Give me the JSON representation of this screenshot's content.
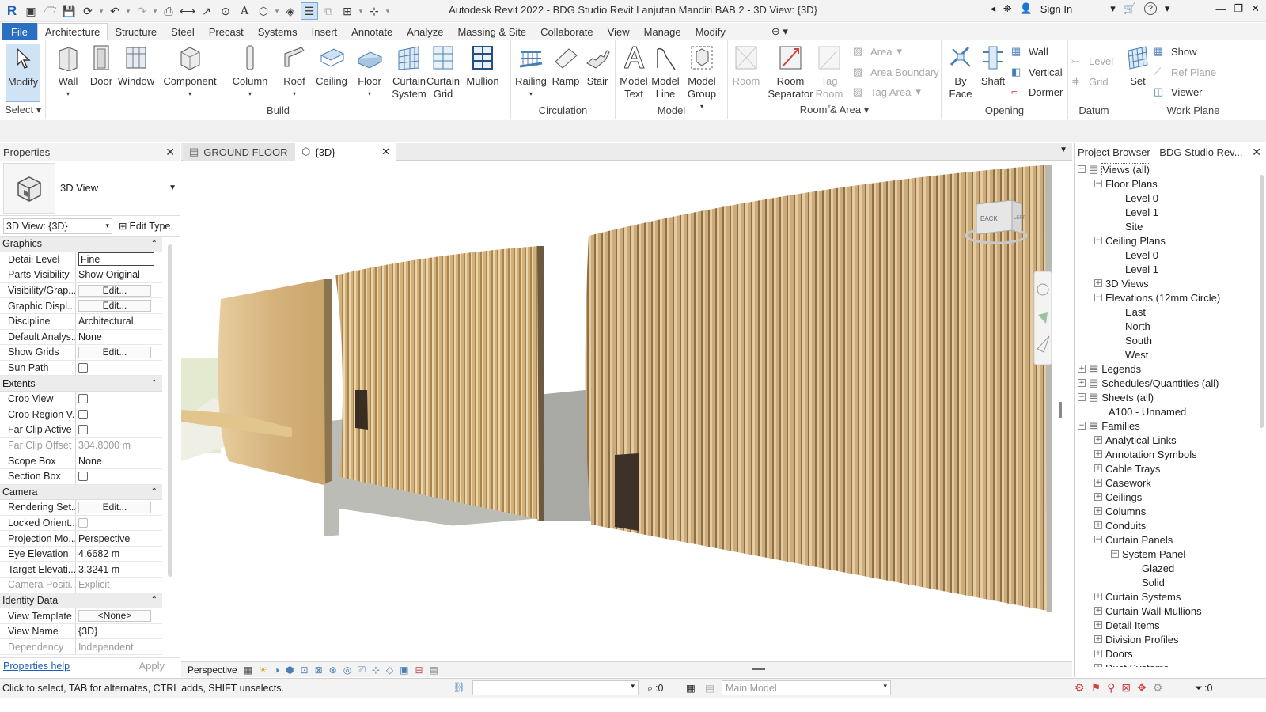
{
  "app": {
    "title": "Autodesk Revit 2022 - BDG Studio Revit Lanjutan Mandiri BAB 2 - 3D View: {3D}",
    "sign_in": "Sign In"
  },
  "ribbon_tabs": [
    "File",
    "Architecture",
    "Structure",
    "Steel",
    "Precast",
    "Systems",
    "Insert",
    "Annotate",
    "Analyze",
    "Massing & Site",
    "Collaborate",
    "View",
    "Manage",
    "Modify"
  ],
  "ribbon": {
    "select": {
      "modify": "Modify",
      "label": "Select"
    },
    "build": {
      "label": "Build",
      "buttons": [
        "Wall",
        "Door",
        "Window",
        "Component",
        "Column",
        "Roof",
        "Ceiling",
        "Floor",
        "Curtain System",
        "Curtain Grid",
        "Mullion"
      ]
    },
    "circulation": {
      "label": "Circulation",
      "buttons": [
        "Railing",
        "Ramp",
        "Stair"
      ]
    },
    "model": {
      "label": "Model",
      "buttons": [
        "Model Text",
        "Model Line",
        "Model Group"
      ]
    },
    "room_area": {
      "label": "Room & Area",
      "room": "Room",
      "room_separator": "Room Separator",
      "tag_room": "Tag Room",
      "area": "Area",
      "area_boundary": "Area  Boundary",
      "tag_area": "Tag  Area"
    },
    "opening": {
      "label": "Opening",
      "by_face": "By Face",
      "shaft": "Shaft",
      "wall": "Wall",
      "vertical": "Vertical",
      "dormer": "Dormer"
    },
    "datum": {
      "label": "Datum",
      "level": "Level",
      "grid": "Grid"
    },
    "work_plane": {
      "label": "Work Plane",
      "set": "Set",
      "show": "Show",
      "ref_plane": "Ref  Plane",
      "viewer": "Viewer"
    }
  },
  "properties": {
    "title": "Properties",
    "type_name": "3D View",
    "selector": "3D View: {3D}",
    "edit_type": "Edit Type",
    "help": "Properties help",
    "apply": "Apply",
    "sections": [
      {
        "name": "Graphics",
        "rows": [
          {
            "k": "Detail Level",
            "v": "Fine",
            "kind": "input"
          },
          {
            "k": "Parts Visibility",
            "v": "Show Original"
          },
          {
            "k": "Visibility/Grap...",
            "v": "Edit...",
            "kind": "button"
          },
          {
            "k": "Graphic Displ...",
            "v": "Edit...",
            "kind": "button"
          },
          {
            "k": "Discipline",
            "v": "Architectural"
          },
          {
            "k": "Default Analys...",
            "v": "None"
          },
          {
            "k": "Show Grids",
            "v": "Edit...",
            "kind": "button"
          },
          {
            "k": "Sun Path",
            "v": "",
            "kind": "check"
          }
        ]
      },
      {
        "name": "Extents",
        "rows": [
          {
            "k": "Crop View",
            "v": "",
            "kind": "check"
          },
          {
            "k": "Crop Region V...",
            "v": "",
            "kind": "check"
          },
          {
            "k": "Far Clip Active",
            "v": "",
            "kind": "check"
          },
          {
            "k": "Far Clip Offset",
            "v": "304.8000 m",
            "kind": "disabled"
          },
          {
            "k": "Scope Box",
            "v": "None"
          },
          {
            "k": "Section Box",
            "v": "",
            "kind": "check"
          }
        ]
      },
      {
        "name": "Camera",
        "rows": [
          {
            "k": "Rendering Set...",
            "v": "Edit...",
            "kind": "button"
          },
          {
            "k": "Locked Orient...",
            "v": "",
            "kind": "checkdis"
          },
          {
            "k": "Projection Mo...",
            "v": "Perspective"
          },
          {
            "k": "Eye Elevation",
            "v": "4.6682 m"
          },
          {
            "k": "Target Elevati...",
            "v": "3.3241 m"
          },
          {
            "k": "Camera Positi...",
            "v": "Explicit",
            "kind": "disabled"
          }
        ]
      },
      {
        "name": "Identity Data",
        "rows": [
          {
            "k": "View Template",
            "v": "<None>",
            "kind": "button"
          },
          {
            "k": "View Name",
            "v": "{3D}"
          },
          {
            "k": "Dependency",
            "v": "Independent",
            "kind": "disabled"
          }
        ]
      }
    ]
  },
  "view_tabs": [
    {
      "label": "GROUND FLOOR"
    },
    {
      "label": "{3D}"
    }
  ],
  "view_bar": {
    "mode": "Perspective"
  },
  "viewcube": {
    "back": "BACK",
    "left": "LEFT"
  },
  "browser": {
    "title": "Project Browser - BDG Studio Rev...",
    "tree": [
      {
        "label": "Views (all)",
        "level": 0,
        "pm": "−",
        "icon": true
      },
      {
        "label": "Floor Plans",
        "level": 1,
        "pm": "−"
      },
      {
        "label": "Level 0",
        "level": 2
      },
      {
        "label": "Level 1",
        "level": 2
      },
      {
        "label": "Site",
        "level": 2
      },
      {
        "label": "Ceiling Plans",
        "level": 1,
        "pm": "−"
      },
      {
        "label": "Level 0",
        "level": 2
      },
      {
        "label": "Level 1",
        "level": 2
      },
      {
        "label": "3D Views",
        "level": 1,
        "pm": "+"
      },
      {
        "label": "Elevations (12mm Circle)",
        "level": 1,
        "pm": "−"
      },
      {
        "label": "East",
        "level": 2
      },
      {
        "label": "North",
        "level": 2
      },
      {
        "label": "South",
        "level": 2
      },
      {
        "label": "West",
        "level": 2
      },
      {
        "label": "Legends",
        "level": 0,
        "pm": "+",
        "icon": true
      },
      {
        "label": "Schedules/Quantities (all)",
        "level": 0,
        "pm": "+",
        "icon": true
      },
      {
        "label": "Sheets (all)",
        "level": 0,
        "pm": "−",
        "icon": true
      },
      {
        "label": "A100 - Unnamed",
        "level": 1
      },
      {
        "label": "Families",
        "level": 0,
        "pm": "−",
        "icon": true
      },
      {
        "label": "Analytical Links",
        "level": 1,
        "pm": "+"
      },
      {
        "label": "Annotation Symbols",
        "level": 1,
        "pm": "+"
      },
      {
        "label": "Cable Trays",
        "level": 1,
        "pm": "+"
      },
      {
        "label": "Casework",
        "level": 1,
        "pm": "+"
      },
      {
        "label": "Ceilings",
        "level": 1,
        "pm": "+"
      },
      {
        "label": "Columns",
        "level": 1,
        "pm": "+"
      },
      {
        "label": "Conduits",
        "level": 1,
        "pm": "+"
      },
      {
        "label": "Curtain Panels",
        "level": 1,
        "pm": "−"
      },
      {
        "label": "System Panel",
        "level": 2,
        "pm": "−"
      },
      {
        "label": "Glazed",
        "level": 3
      },
      {
        "label": "Solid",
        "level": 3
      },
      {
        "label": "Curtain Systems",
        "level": 1,
        "pm": "+"
      },
      {
        "label": "Curtain Wall Mullions",
        "level": 1,
        "pm": "+"
      },
      {
        "label": "Detail Items",
        "level": 1,
        "pm": "+"
      },
      {
        "label": "Division Profiles",
        "level": 1,
        "pm": "+"
      },
      {
        "label": "Doors",
        "level": 1,
        "pm": "+"
      },
      {
        "label": "Duct Systems",
        "level": 1,
        "pm": "+"
      }
    ]
  },
  "status": {
    "message": "Click to select, TAB for alternates, CTRL adds, SHIFT unselects.",
    "workset_count": ":0",
    "model": "Main Model",
    "filter_count": ":0"
  }
}
